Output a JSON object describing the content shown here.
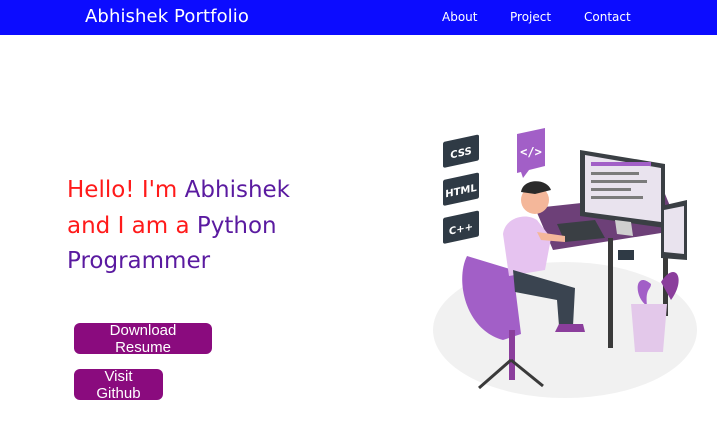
{
  "navbar": {
    "brand": "Abhishek Portfolio",
    "links": [
      "About",
      "Project",
      "Contact"
    ]
  },
  "hero": {
    "line1_red": "Hello! I'm ",
    "line1_purple": "Abhishek",
    "line2_red": "and I am a ",
    "line2_purple": "Python",
    "line3_purple": "Programmer"
  },
  "buttons": {
    "download_resume": "Download Resume",
    "visit_github": "Visit Github"
  },
  "illustration": {
    "tags": [
      "CSS",
      "HTML",
      "C++"
    ],
    "code_tag": "</>"
  },
  "colors": {
    "nav_bg": "#0c0cff",
    "red_text": "#ff1a1a",
    "purple_text": "#5a1aa0",
    "button_bg": "#8a0b7e",
    "illustration_purple": "#a25fc7"
  }
}
